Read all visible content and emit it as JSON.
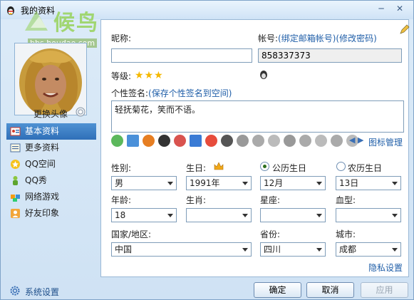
{
  "window": {
    "title": "我的资料"
  },
  "watermark": {
    "brand": "候鸟",
    "url": "bbs.houdao.com"
  },
  "left": {
    "change_avatar": "更换头像",
    "nav": [
      {
        "label": "基本资料",
        "active": true
      },
      {
        "label": "更多资料"
      },
      {
        "label": "QQ空间"
      },
      {
        "label": "QQ秀"
      },
      {
        "label": "网络游戏"
      },
      {
        "label": "好友印象"
      }
    ]
  },
  "profile": {
    "nickname_label": "昵称:",
    "nickname_value": "",
    "account_label": "帐号:",
    "bind_email_link": "(绑定邮箱帐号)",
    "change_password_link": "(修改密码)",
    "account_value": "858337373",
    "level_label": "等级:",
    "level_stars": 3,
    "signature_label": "个性签名:",
    "save_signature_link": "(保存个性签名到空间)",
    "signature_value": "轻抚菊花，笑而不语。",
    "icon_manage_link": "图标管理"
  },
  "details": {
    "gender_label": "性别:",
    "gender_value": "男",
    "birthday_label": "生日:",
    "birth_year": "1991年",
    "solar_label": "公历生日",
    "lunar_label": "农历生日",
    "birth_month": "12月",
    "birth_day": "13日",
    "age_label": "年龄:",
    "age_value": "18",
    "zodiac_label": "生肖:",
    "zodiac_value": "",
    "constellation_label": "星座:",
    "constellation_value": "",
    "blood_label": "血型:",
    "blood_value": "",
    "country_label": "国家/地区:",
    "country_value": "中国",
    "province_label": "省份:",
    "province_value": "四川",
    "city_label": "城市:",
    "city_value": "成都",
    "privacy_link": "隐私设置"
  },
  "footer": {
    "system_settings": "系统设置",
    "ok": "确定",
    "cancel": "取消",
    "apply": "应用"
  }
}
